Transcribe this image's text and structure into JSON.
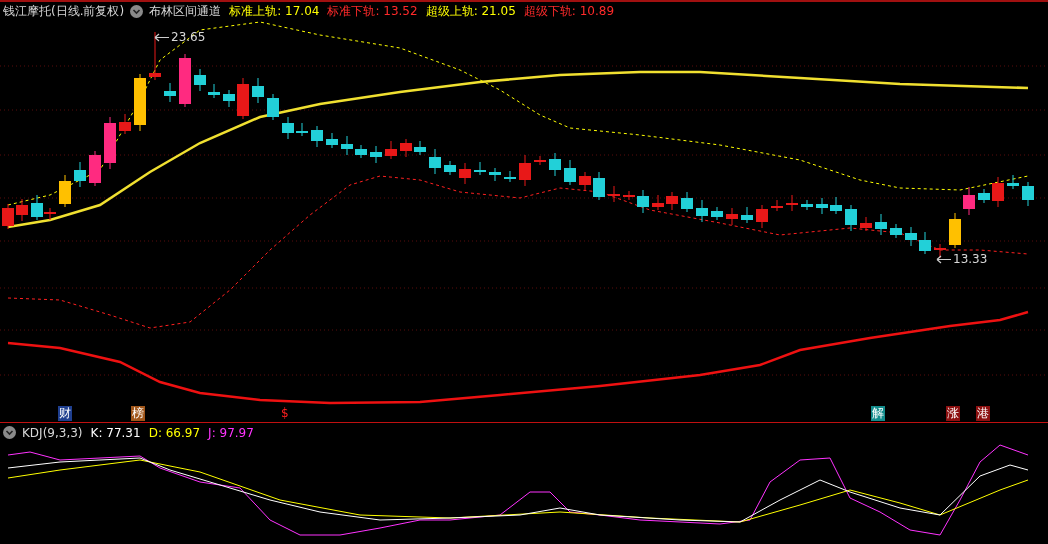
{
  "header": {
    "stock_title": "钱江摩托(日线.前复权)",
    "indicator_name": "布林区间通道",
    "readings": [
      {
        "text": "标准上轨: 17.04",
        "color": "#ffff00"
      },
      {
        "text": "标准下轨: 13.52",
        "color": "#ff2a2a"
      },
      {
        "text": "超级上轨: 21.05",
        "color": "#ffff00"
      },
      {
        "text": "超级下轨: 10.89",
        "color": "#ff2a2a"
      }
    ]
  },
  "price_labels": [
    {
      "text": "23.65"
    },
    {
      "text": "13.33"
    }
  ],
  "event_markers": [
    {
      "text": "财",
      "color": "#1f3f8f"
    },
    {
      "text": "榜",
      "color": "#a0561a"
    },
    {
      "text": "$",
      "color": "#000000"
    },
    {
      "text": "解",
      "color": "#138c8c"
    },
    {
      "text": "涨",
      "color": "#8c1010"
    },
    {
      "text": "港",
      "color": "#8c1010"
    }
  ],
  "kdj": {
    "title": "KDJ(9,3,3)",
    "readings": [
      {
        "text": "K: 77.31",
        "color": "#ffffff"
      },
      {
        "text": "D: 66.97",
        "color": "#ffff00"
      },
      {
        "text": "J: 97.97",
        "color": "#ff33ff"
      }
    ]
  }
}
